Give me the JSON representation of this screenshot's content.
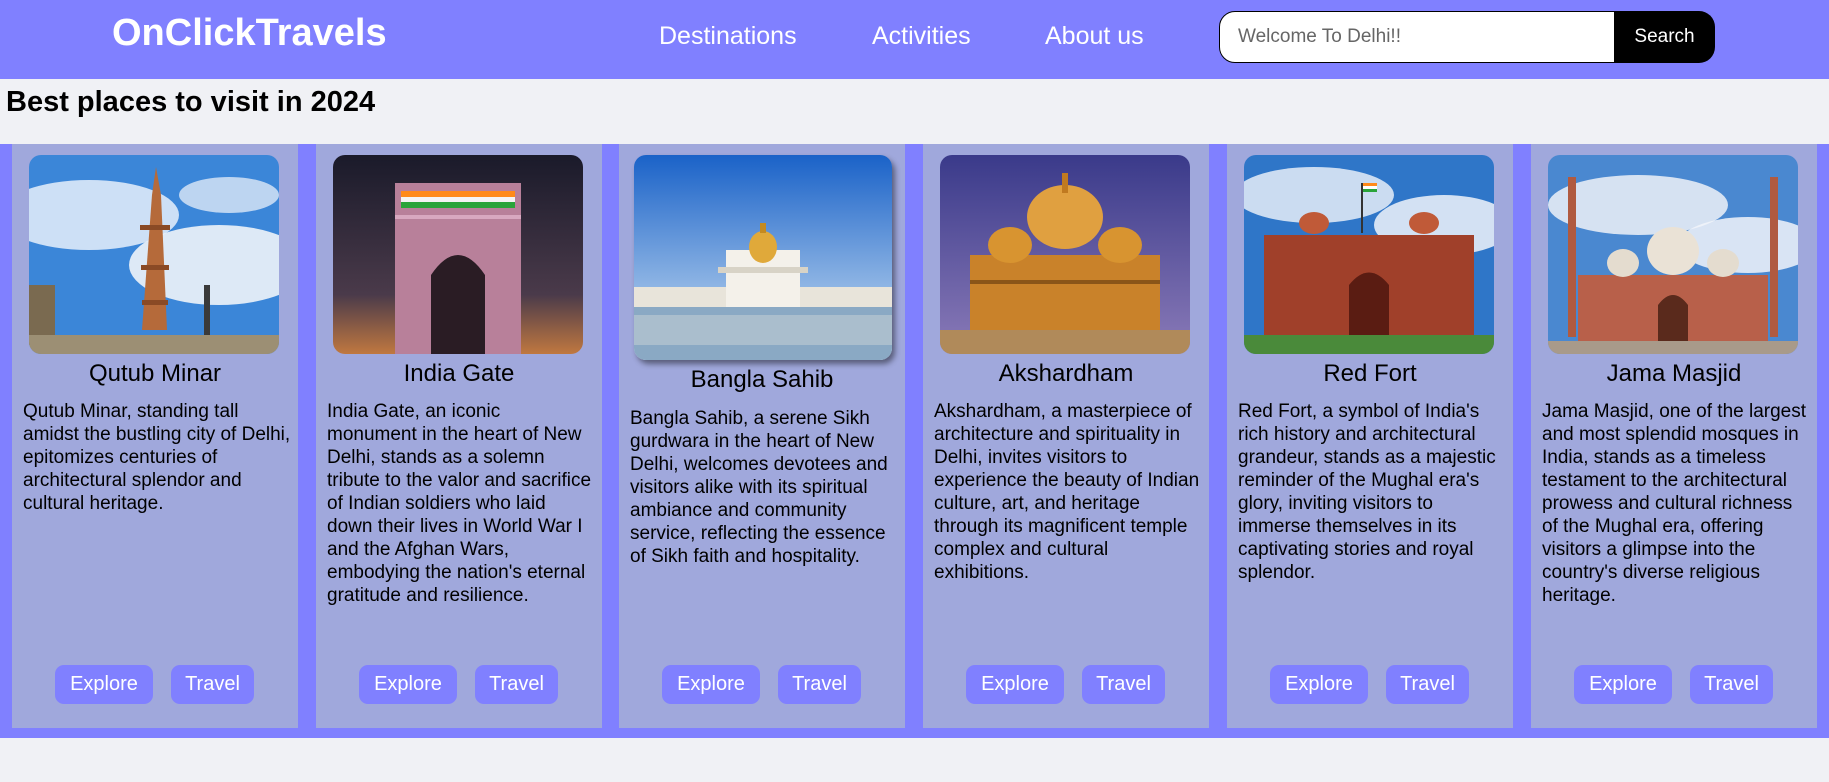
{
  "header": {
    "brand": "OnClickTravels",
    "nav": [
      "Destinations",
      "Activities",
      "About us"
    ],
    "search": {
      "placeholder": "Welcome To Delhi!!",
      "button": "Search"
    }
  },
  "section": {
    "heading": "Best places to visit in 2024"
  },
  "cards": [
    {
      "title": "Qutub Minar",
      "description": "Qutub Minar, standing tall amidst the bustling city of Delhi, epitomizes centuries of architectural splendor and cultural heritage.",
      "explore": "Explore",
      "travel": "Travel"
    },
    {
      "title": "India Gate",
      "description": "India Gate, an iconic monument in the heart of New Delhi, stands as a solemn tribute to the valor and sacrifice of Indian soldiers who laid down their lives in World War I and the Afghan Wars, embodying the nation's eternal gratitude and resilience.",
      "explore": "Explore",
      "travel": "Travel"
    },
    {
      "title": "Bangla Sahib",
      "description": "Bangla Sahib, a serene Sikh gurdwara in the heart of New Delhi, welcomes devotees and visitors alike with its spiritual ambiance and community service, reflecting the essence of Sikh faith and hospitality.",
      "explore": "Explore",
      "travel": "Travel"
    },
    {
      "title": "Akshardham",
      "description": "Akshardham, a masterpiece of architecture and spirituality in Delhi, invites visitors to experience the beauty of Indian culture, art, and heritage through its magnificent temple complex and cultural exhibitions.",
      "explore": "Explore",
      "travel": "Travel"
    },
    {
      "title": "Red Fort",
      "description": "Red Fort, a symbol of India's rich history and architectural grandeur, stands as a majestic reminder of the Mughal era's glory, inviting visitors to immerse themselves in its captivating stories and royal splendor.",
      "explore": "Explore",
      "travel": "Travel"
    },
    {
      "title": "Jama Masjid",
      "description": "Jama Masjid, one of the largest and most splendid mosques in India, stands as a timeless testament to the architectural prowess and cultural richness of the Mughal era, offering visitors a glimpse into the country's diverse religious heritage.",
      "explore": "Explore",
      "travel": "Travel"
    }
  ],
  "colors": {
    "nav": "#8080ff",
    "card": "#a0a8dc",
    "page": "#f0f1f5",
    "search_button": "#000000"
  }
}
